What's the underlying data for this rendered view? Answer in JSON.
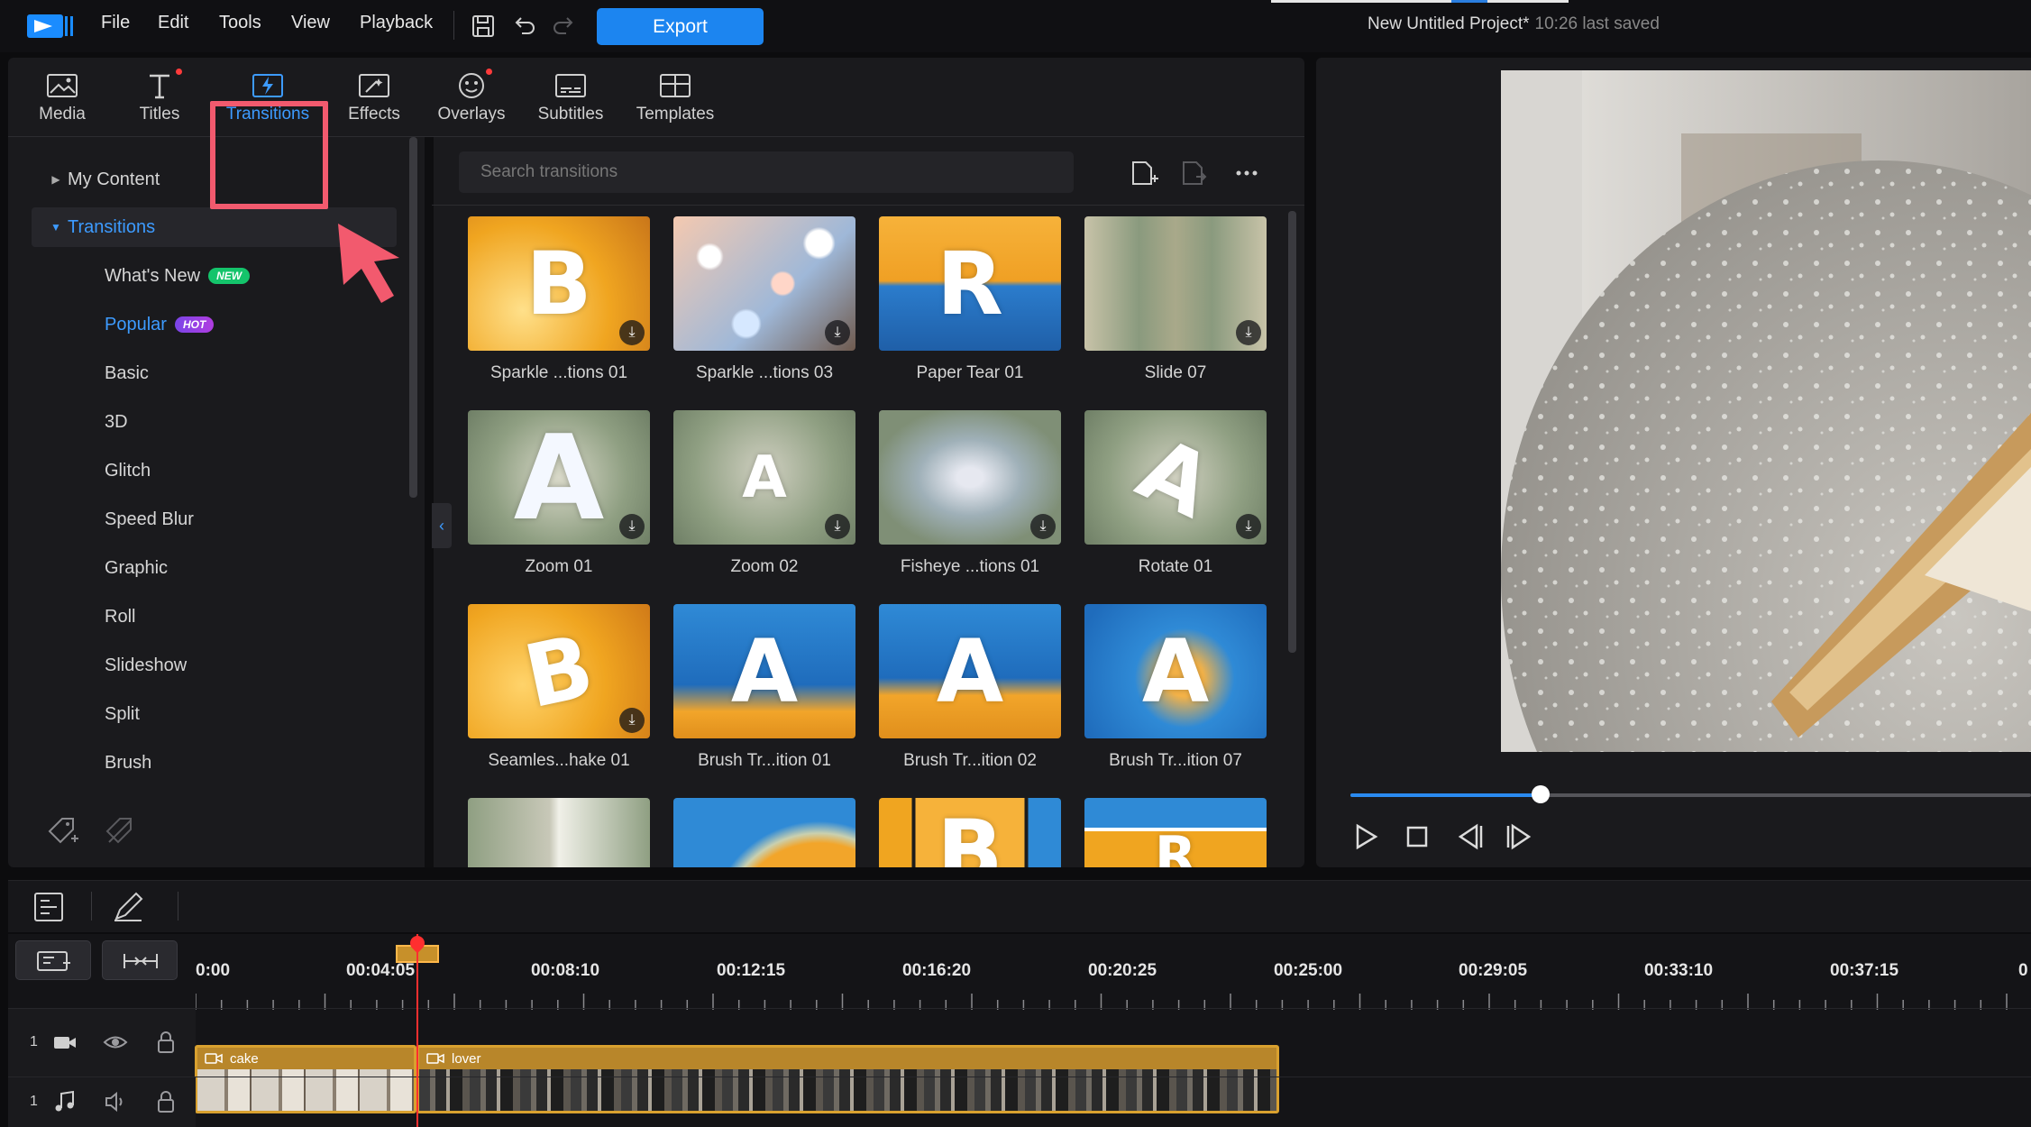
{
  "menu": [
    "File",
    "Edit",
    "Tools",
    "View",
    "Playback"
  ],
  "export_label": "Export",
  "project": {
    "title": "New Untitled Project*",
    "saved": "10:26 last saved"
  },
  "rooms": [
    {
      "label": "Media",
      "icon": "media-icon"
    },
    {
      "label": "Titles",
      "icon": "titles-icon"
    },
    {
      "label": "Transitions",
      "icon": "transitions-icon"
    },
    {
      "label": "Effects",
      "icon": "effects-icon"
    },
    {
      "label": "Overlays",
      "icon": "overlays-icon"
    },
    {
      "label": "Subtitles",
      "icon": "subtitles-icon"
    },
    {
      "label": "Templates",
      "icon": "templates-icon"
    }
  ],
  "active_room": "Transitions",
  "tree": {
    "my_content": "My Content",
    "transitions": "Transitions",
    "children": [
      {
        "label": "What's New",
        "badge": "NEW"
      },
      {
        "label": "Popular",
        "badge": "HOT"
      },
      {
        "label": "Basic"
      },
      {
        "label": "3D"
      },
      {
        "label": "Glitch"
      },
      {
        "label": "Speed Blur"
      },
      {
        "label": "Graphic"
      },
      {
        "label": "Roll"
      },
      {
        "label": "Slideshow"
      },
      {
        "label": "Split"
      },
      {
        "label": "Brush"
      }
    ]
  },
  "search": {
    "placeholder": "Search transitions"
  },
  "transitions": [
    {
      "name": "Sparkle ...tions 01",
      "glyph": "B"
    },
    {
      "name": "Sparkle ...tions 03",
      "glyph": ""
    },
    {
      "name": "Paper Tear 01",
      "glyph": "R"
    },
    {
      "name": "Slide 07",
      "glyph": ""
    },
    {
      "name": "Zoom 01",
      "glyph": "A"
    },
    {
      "name": "Zoom 02",
      "glyph": "A"
    },
    {
      "name": "Fisheye ...tions 01",
      "glyph": ""
    },
    {
      "name": "Rotate 01",
      "glyph": "A"
    },
    {
      "name": "Seamles...hake 01",
      "glyph": "B"
    },
    {
      "name": "Brush Tr...ition 01",
      "glyph": "A"
    },
    {
      "name": "Brush Tr...ition 02",
      "glyph": "A"
    },
    {
      "name": "Brush Tr...ition 07",
      "glyph": "A"
    },
    {
      "name": "",
      "glyph": ""
    },
    {
      "name": "",
      "glyph": ""
    },
    {
      "name": "",
      "glyph": "B"
    },
    {
      "name": "",
      "glyph": "R"
    }
  ],
  "playback": {
    "progress": 0.28
  },
  "timeline": {
    "timecodes": [
      "0:00",
      "00:04:05",
      "00:08:10",
      "00:12:15",
      "00:16:20",
      "00:20:25",
      "00:25:00",
      "00:29:05",
      "00:33:10",
      "00:37:15",
      "0"
    ],
    "tracks": [
      {
        "num": "1",
        "type": "video",
        "clips": [
          "cake",
          "lover"
        ]
      },
      {
        "num": "1",
        "type": "audio",
        "clips": []
      }
    ]
  },
  "colors": {
    "accent": "#3d9bff",
    "export": "#1c85f0",
    "highlight": "#f25a6e",
    "playhead": "#ff2f2f",
    "clip": "#d9a12f"
  }
}
